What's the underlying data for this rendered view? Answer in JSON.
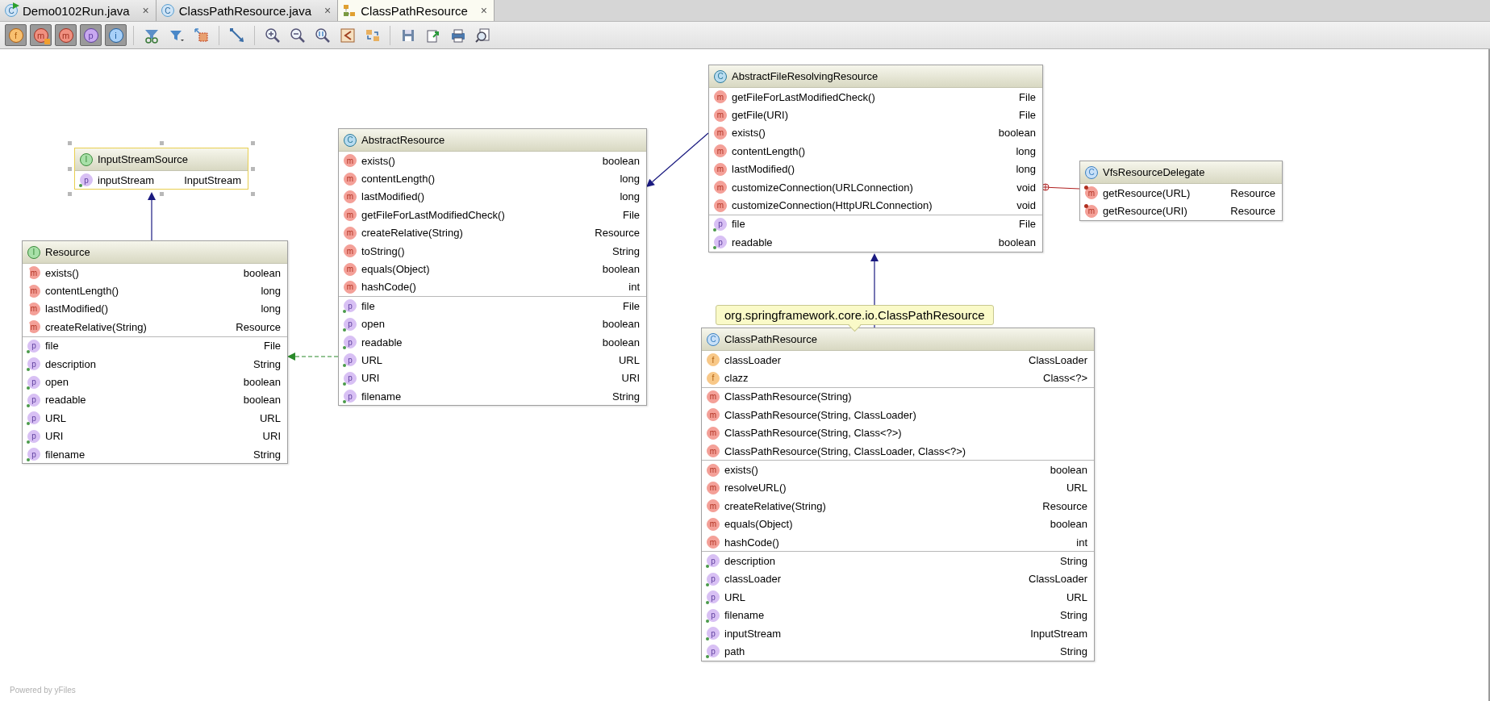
{
  "tabs": [
    {
      "label": "Demo0102Run.java",
      "kind": "runnable_class",
      "icon": "C",
      "close": "×",
      "selected": false
    },
    {
      "label": "ClassPathResource.java",
      "kind": "class",
      "icon": "C",
      "close": "×",
      "selected": false
    },
    {
      "label": "ClassPathResource",
      "kind": "diagram",
      "close": "×",
      "selected": true
    }
  ],
  "toolbar": {
    "toggles": [
      {
        "kind": "fields",
        "icon": "f",
        "on": true
      },
      {
        "kind": "constructors",
        "icon": "m",
        "on": true
      },
      {
        "kind": "methods",
        "icon": "m",
        "on": true
      },
      {
        "kind": "properties",
        "icon": "p",
        "on": true
      },
      {
        "kind": "inner_classes",
        "icon": "i",
        "on": true
      }
    ]
  },
  "diagram": {
    "nodes": [
      {
        "name": "InputStreamSource",
        "kind": "interface",
        "icon": "I",
        "selected": true,
        "sections": [
          [
            {
              "kind": "property",
              "icon": "p",
              "name": "inputStream",
              "type": "InputStream"
            }
          ]
        ]
      },
      {
        "name": "Resource",
        "kind": "interface",
        "icon": "I",
        "selected": false,
        "sections": [
          [
            {
              "kind": "abstract_method",
              "icon": "m",
              "name": "exists()",
              "type": "boolean"
            },
            {
              "kind": "abstract_method",
              "icon": "m",
              "name": "contentLength()",
              "type": "long"
            },
            {
              "kind": "abstract_method",
              "icon": "m",
              "name": "lastModified()",
              "type": "long"
            },
            {
              "kind": "abstract_method",
              "icon": "m",
              "name": "createRelative(String)",
              "type": "Resource"
            }
          ],
          [
            {
              "kind": "property",
              "icon": "p",
              "name": "file",
              "type": "File"
            },
            {
              "kind": "property",
              "icon": "p",
              "name": "description",
              "type": "String"
            },
            {
              "kind": "property",
              "icon": "p",
              "name": "open",
              "type": "boolean"
            },
            {
              "kind": "property",
              "icon": "p",
              "name": "readable",
              "type": "boolean"
            },
            {
              "kind": "property",
              "icon": "p",
              "name": "URL",
              "type": "URL"
            },
            {
              "kind": "property",
              "icon": "p",
              "name": "URI",
              "type": "URI"
            },
            {
              "kind": "property",
              "icon": "p",
              "name": "filename",
              "type": "String"
            }
          ]
        ]
      },
      {
        "name": "AbstractResource",
        "kind": "abstract_class",
        "icon": "C",
        "selected": false,
        "sections": [
          [
            {
              "kind": "method",
              "icon": "m",
              "name": "exists()",
              "type": "boolean"
            },
            {
              "kind": "method",
              "icon": "m",
              "name": "contentLength()",
              "type": "long"
            },
            {
              "kind": "method",
              "icon": "m",
              "name": "lastModified()",
              "type": "long"
            },
            {
              "kind": "method",
              "icon": "m",
              "name": "getFileForLastModifiedCheck()",
              "type": "File"
            },
            {
              "kind": "method",
              "icon": "m",
              "name": "createRelative(String)",
              "type": "Resource"
            },
            {
              "kind": "method",
              "icon": "m",
              "name": "toString()",
              "type": "String"
            },
            {
              "kind": "method",
              "icon": "m",
              "name": "equals(Object)",
              "type": "boolean"
            },
            {
              "kind": "method",
              "icon": "m",
              "name": "hashCode()",
              "type": "int"
            }
          ],
          [
            {
              "kind": "property",
              "icon": "p",
              "name": "file",
              "type": "File"
            },
            {
              "kind": "property",
              "icon": "p",
              "name": "open",
              "type": "boolean"
            },
            {
              "kind": "property",
              "icon": "p",
              "name": "readable",
              "type": "boolean"
            },
            {
              "kind": "property",
              "icon": "p",
              "name": "URL",
              "type": "URL"
            },
            {
              "kind": "property",
              "icon": "p",
              "name": "URI",
              "type": "URI"
            },
            {
              "kind": "property",
              "icon": "p",
              "name": "filename",
              "type": "String"
            }
          ]
        ]
      },
      {
        "name": "AbstractFileResolvingResource",
        "kind": "abstract_class",
        "icon": "C",
        "selected": false,
        "sections": [
          [
            {
              "kind": "method",
              "icon": "m",
              "name": "getFileForLastModifiedCheck()",
              "type": "File"
            },
            {
              "kind": "method",
              "icon": "m",
              "name": "getFile(URI)",
              "type": "File"
            },
            {
              "kind": "method",
              "icon": "m",
              "name": "exists()",
              "type": "boolean"
            },
            {
              "kind": "method",
              "icon": "m",
              "name": "contentLength()",
              "type": "long"
            },
            {
              "kind": "method",
              "icon": "m",
              "name": "lastModified()",
              "type": "long"
            },
            {
              "kind": "method",
              "icon": "m",
              "name": "customizeConnection(URLConnection)",
              "type": "void"
            },
            {
              "kind": "method",
              "icon": "m",
              "name": "customizeConnection(HttpURLConnection)",
              "type": "void"
            }
          ],
          [
            {
              "kind": "property",
              "icon": "p",
              "name": "file",
              "type": "File"
            },
            {
              "kind": "property",
              "icon": "p",
              "name": "readable",
              "type": "boolean"
            }
          ]
        ]
      },
      {
        "name": "VfsResourceDelegate",
        "kind": "class",
        "icon": "C",
        "selected": false,
        "sections": [
          [
            {
              "kind": "static_method",
              "icon": "m",
              "name": "getResource(URL)",
              "type": "Resource"
            },
            {
              "kind": "static_method",
              "icon": "m",
              "name": "getResource(URI)",
              "type": "Resource"
            }
          ]
        ]
      },
      {
        "name": "ClassPathResource",
        "kind": "class",
        "icon": "C",
        "selected": false,
        "sections": [
          [
            {
              "kind": "field",
              "icon": "f",
              "name": "classLoader",
              "type": "ClassLoader"
            },
            {
              "kind": "field",
              "icon": "f",
              "name": "clazz",
              "type": "Class<?>"
            }
          ],
          [
            {
              "kind": "method",
              "icon": "m",
              "name": "ClassPathResource(String)"
            },
            {
              "kind": "method",
              "icon": "m",
              "name": "ClassPathResource(String, ClassLoader)"
            },
            {
              "kind": "method",
              "icon": "m",
              "name": "ClassPathResource(String, Class<?>)"
            },
            {
              "kind": "method",
              "icon": "m",
              "name": "ClassPathResource(String, ClassLoader, Class<?>)"
            }
          ],
          [
            {
              "kind": "method",
              "icon": "m",
              "name": "exists()",
              "type": "boolean"
            },
            {
              "kind": "method",
              "icon": "m",
              "name": "resolveURL()",
              "type": "URL"
            },
            {
              "kind": "method",
              "icon": "m",
              "name": "createRelative(String)",
              "type": "Resource"
            },
            {
              "kind": "method",
              "icon": "m",
              "name": "equals(Object)",
              "type": "boolean"
            },
            {
              "kind": "method",
              "icon": "m",
              "name": "hashCode()",
              "type": "int"
            }
          ],
          [
            {
              "kind": "property",
              "icon": "p",
              "name": "description",
              "type": "String"
            },
            {
              "kind": "property",
              "icon": "p",
              "name": "classLoader",
              "type": "ClassLoader"
            },
            {
              "kind": "property",
              "icon": "p",
              "name": "URL",
              "type": "URL"
            },
            {
              "kind": "property",
              "icon": "p",
              "name": "filename",
              "type": "String"
            },
            {
              "kind": "property",
              "icon": "p",
              "name": "inputStream",
              "type": "InputStream"
            },
            {
              "kind": "property",
              "icon": "p",
              "name": "path",
              "type": "String"
            }
          ]
        ]
      }
    ],
    "edges": [
      {
        "kind": "extends"
      },
      {
        "kind": "implements"
      },
      {
        "kind": "extends"
      },
      {
        "kind": "extends"
      },
      {
        "kind": "inner"
      }
    ],
    "tooltip": "org.springframework.core.io.ClassPathResource",
    "footer": "Powered by yFiles"
  }
}
